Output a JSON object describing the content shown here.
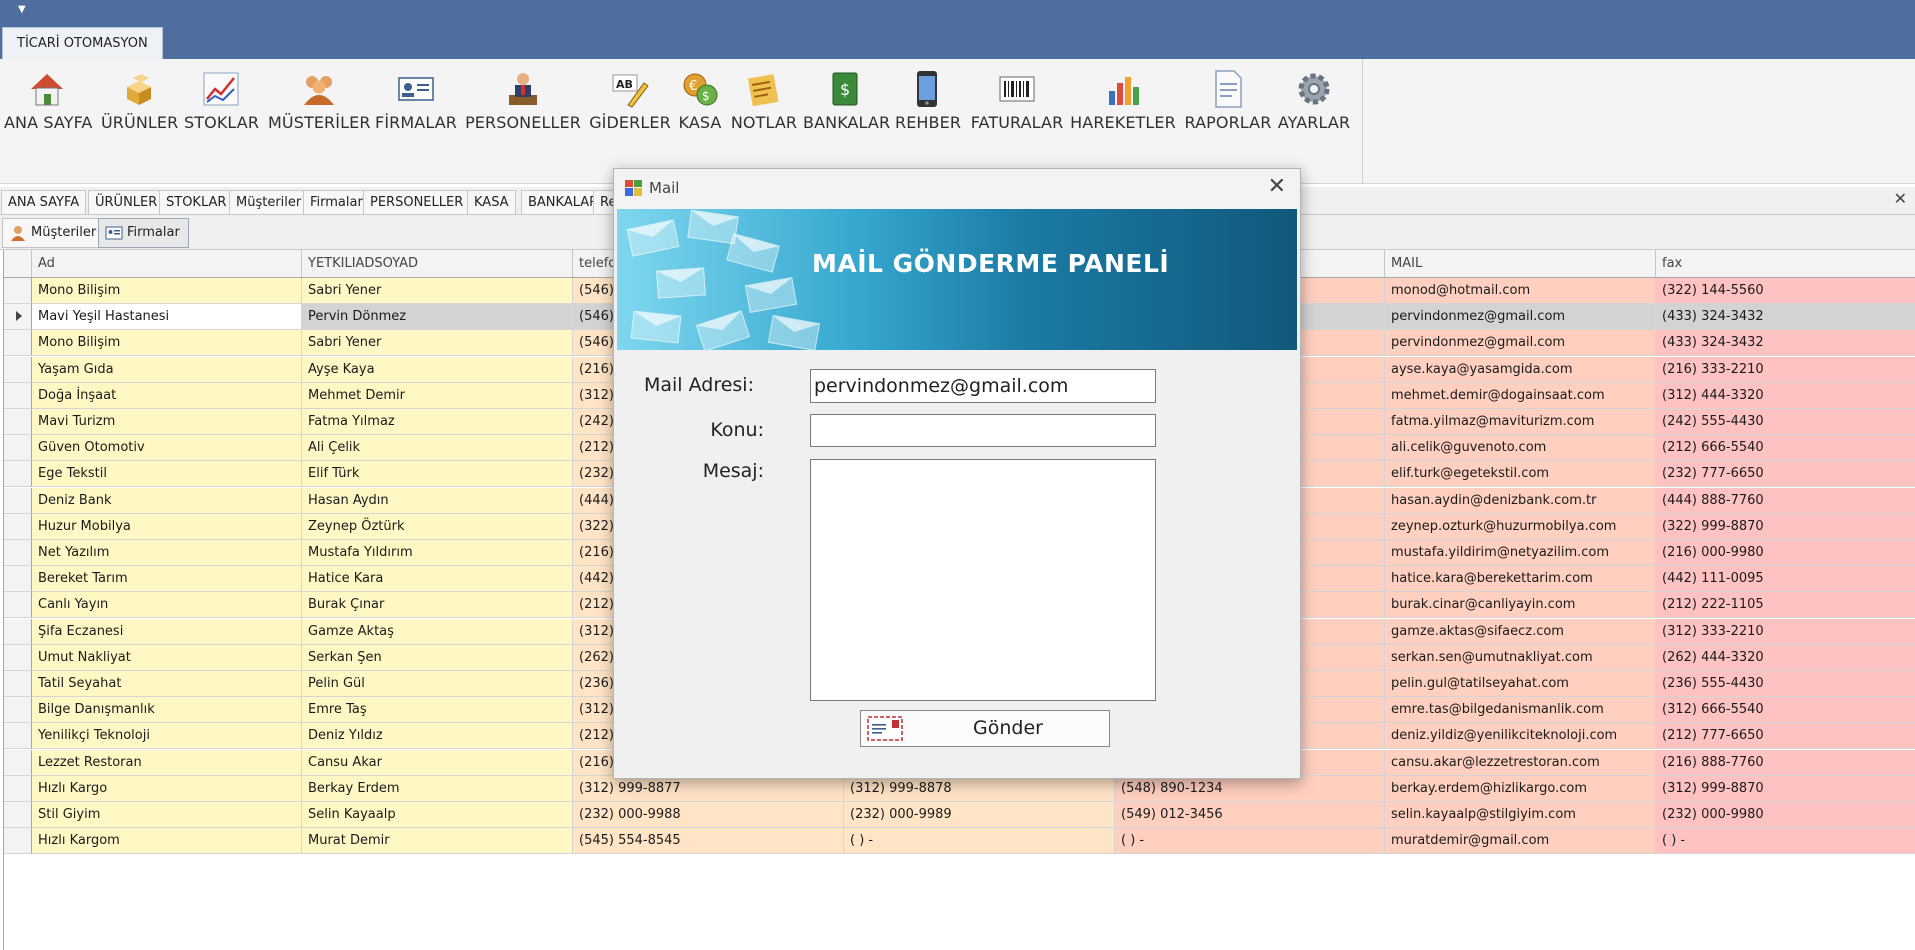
{
  "ribbon": {
    "tab_label": "TİCARİ OTOMASYON",
    "buttons": [
      {
        "label": "ANA SAYFA",
        "icon": "home-icon"
      },
      {
        "label": "ÜRÜNLER",
        "icon": "boxes-icon"
      },
      {
        "label": "STOKLAR",
        "icon": "chart-line-icon"
      },
      {
        "label": "MÜSTERİLER",
        "icon": "customers-icon"
      },
      {
        "label": "FİRMALAR",
        "icon": "id-card-icon"
      },
      {
        "label": "PERSONELLER",
        "icon": "employee-icon"
      },
      {
        "label": "GİDERLER",
        "icon": "pencil-ab-icon"
      },
      {
        "label": "KASA",
        "icon": "coins-icon"
      },
      {
        "label": "NOTLAR",
        "icon": "notes-icon"
      },
      {
        "label": "BANKALAR",
        "icon": "money-book-icon"
      },
      {
        "label": "REHBER",
        "icon": "phone-icon"
      },
      {
        "label": "FATURALAR",
        "icon": "barcode-icon"
      },
      {
        "label": "HAREKETLER",
        "icon": "bar-chart-icon"
      },
      {
        "label": "RAPORLAR",
        "icon": "document-icon"
      },
      {
        "label": "AYARLAR",
        "icon": "gear-icon"
      }
    ]
  },
  "doc_tabs": [
    "ANA SAYFA",
    "ÜRÜNLER",
    "STOKLAR",
    "Müşteriler",
    "Firmalar",
    "PERSONELLER",
    "KASA",
    "BANKALAR",
    "Re"
  ],
  "sub_tabs": [
    "Müşteriler",
    "Firmalar"
  ],
  "grid": {
    "columns": [
      "Ad",
      "YETKILIADSOYAD",
      "telefo",
      "",
      "",
      "MAIL",
      "fax"
    ],
    "rows": [
      [
        "Mono Bilişim",
        "Sabri Yener",
        "(546)",
        "",
        "",
        "monod@hotmail.com",
        "(322) 144-5560"
      ],
      [
        "Mavi Yeşil Hastanesi",
        "Pervin Dönmez",
        "(546)",
        "",
        "",
        "pervindonmez@gmail.com",
        "(433) 324-3432"
      ],
      [
        "Mono Bilişim",
        "Sabri Yener",
        "(546)",
        "",
        "",
        "pervindonmez@gmail.com",
        "(433) 324-3432"
      ],
      [
        "Yaşam Gıda",
        "Ayşe Kaya",
        "(216)",
        "",
        "",
        "ayse.kaya@yasamgida.com",
        "(216) 333-2210"
      ],
      [
        "Doğa İnşaat",
        "Mehmet Demir",
        "(312)",
        "",
        "",
        "mehmet.demir@dogainsaat.com",
        "(312) 444-3320"
      ],
      [
        "Mavi Turizm",
        "Fatma Yılmaz",
        "(242)",
        "",
        "",
        "fatma.yilmaz@maviturizm.com",
        "(242) 555-4430"
      ],
      [
        "Güven Otomotiv",
        "Ali Çelik",
        "(212)",
        "",
        "",
        "ali.celik@guvenoto.com",
        "(212) 666-5540"
      ],
      [
        "Ege Tekstil",
        "Elif Türk",
        "(232)",
        "",
        "",
        "elif.turk@egetekstil.com",
        "(232) 777-6650"
      ],
      [
        "Deniz Bank",
        "Hasan Aydın",
        "(444)",
        "",
        "",
        "hasan.aydin@denizbank.com.tr",
        "(444) 888-7760"
      ],
      [
        "Huzur Mobilya",
        "Zeynep Öztürk",
        "(322)",
        "",
        "",
        "zeynep.ozturk@huzurmobilya.com",
        "(322) 999-8870"
      ],
      [
        "Net Yazılım",
        "Mustafa Yıldırım",
        "(216)",
        "",
        "",
        "mustafa.yildirim@netyazilim.com",
        "(216) 000-9980"
      ],
      [
        "Bereket Tarım",
        "Hatice Kara",
        "(442)",
        "",
        "",
        "hatice.kara@berekettarim.com",
        "(442) 111-0095"
      ],
      [
        "Canlı Yayın",
        "Burak Çınar",
        "(212)",
        "",
        "",
        "burak.cinar@canliyayin.com",
        "(212) 222-1105"
      ],
      [
        "Şifa Eczanesi",
        "Gamze Aktaş",
        "(312)",
        "",
        "",
        "gamze.aktas@sifaecz.com",
        "(312) 333-2210"
      ],
      [
        "Umut Nakliyat",
        "Serkan Şen",
        "(262)",
        "",
        "",
        "serkan.sen@umutnakliyat.com",
        "(262) 444-3320"
      ],
      [
        "Tatil Seyahat",
        "Pelin Gül",
        "(236)",
        "",
        "",
        "pelin.gul@tatilseyahat.com",
        "(236) 555-4430"
      ],
      [
        "Bilge Danışmanlık",
        "Emre Taş",
        "(312)",
        "",
        "",
        "emre.tas@bilgedanismanlik.com",
        "(312) 666-5540"
      ],
      [
        "Yenilikçi Teknoloji",
        "Deniz Yıldız",
        "(212)",
        "",
        "",
        "deniz.yildiz@yenilikciteknoloji.com",
        "(212) 777-6650"
      ],
      [
        "Lezzet Restoran",
        "Cansu Akar",
        "(216)",
        "",
        "",
        "cansu.akar@lezzetrestoran.com",
        "(216) 888-7760"
      ],
      [
        "Hızlı Kargo",
        "Berkay Erdem",
        "(312) 999-8877",
        "(312) 999-8878",
        "(548) 890-1234",
        "berkay.erdem@hizlikargo.com",
        "(312) 999-8870"
      ],
      [
        "Stil Giyim",
        "Selin Kayaalp",
        "(232) 000-9988",
        "(232) 000-9989",
        "(549) 012-3456",
        "selin.kayaalp@stilgiyim.com",
        "(232) 000-9980"
      ],
      [
        "Hızlı Kargom",
        "Murat Demir",
        "(545) 554-8545",
        "(  )    -",
        "(  )    -",
        "muratdemir@gmail.com",
        "(  )    -"
      ]
    ],
    "selected_row": 1
  },
  "dialog": {
    "title": "Mail",
    "banner_heading": "MAİL GÖNDERME PANELİ",
    "mail_label": "Mail Adresi:",
    "mail_value": "pervindonmez@gmail.com",
    "subject_label": "Konu:",
    "subject_value": "",
    "message_label": "Mesaj:",
    "message_value": "",
    "send_label": "Gönder"
  },
  "colors": {
    "ribbon_bar": "#4e6e9f",
    "col_yellow": "#fff7c4",
    "col_peach": "#ffe4c6",
    "col_salmon": "#ffcfc0",
    "col_pink": "#ffc2c2",
    "selected_row": "#d3d3d3"
  }
}
